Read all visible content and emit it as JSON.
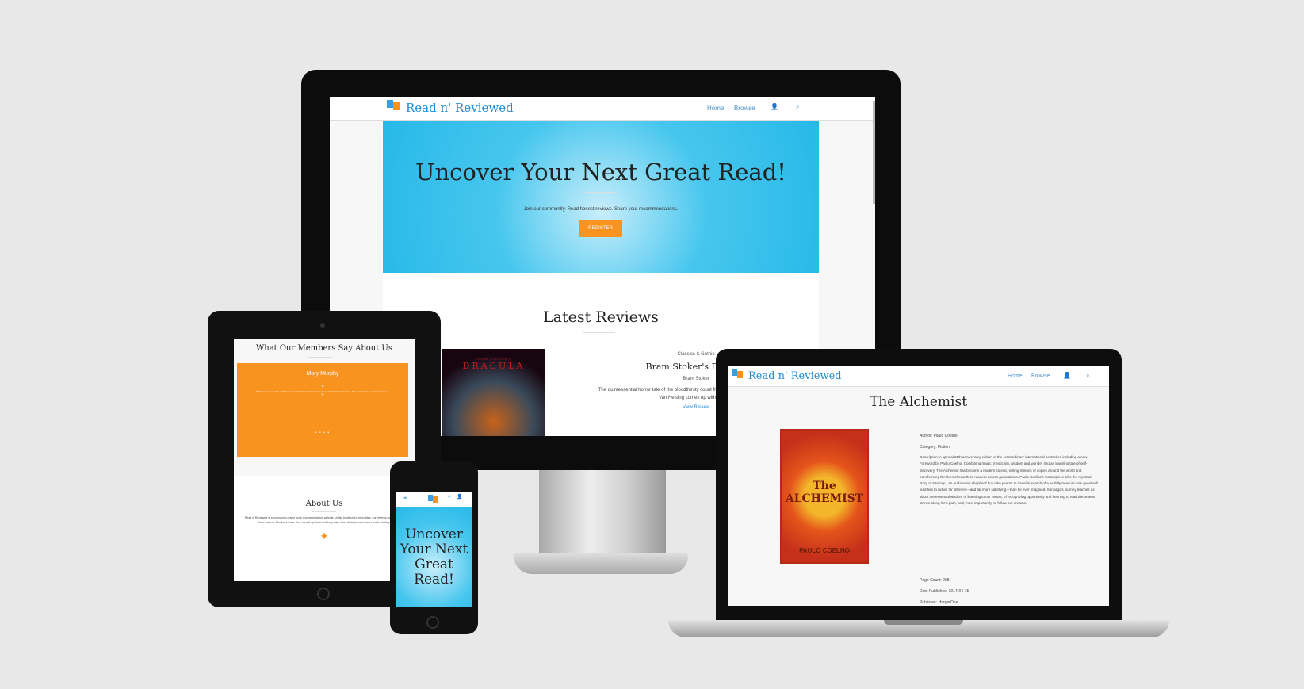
{
  "brand": "Read n' Reviewed",
  "nav": {
    "home": "Home",
    "browse": "Browse"
  },
  "desktop": {
    "hero_title": "Uncover Your Next Great Read!",
    "hero_subtitle": "Join our community. Read honest reviews. Share your recommendations.",
    "register": "REGISTER",
    "latest_title": "Latest Reviews",
    "review": {
      "cover_top": "BRAM STOKER'S",
      "cover_title": "DRACULA",
      "category": "Classics & Gothic",
      "title": "Bram Stoker's Dracula",
      "author": "Bram Stoker",
      "desc": "The quintessential horror tale of the bloodthirsty count from the mountains of Central Europe. Van Helsing comes up with a way...",
      "link": "View Review"
    }
  },
  "tablet": {
    "testimonials_title": "What Our Members Say About Us",
    "member": "Mary Murphy",
    "quote": "What I love about this platform is how it helps me discover books I wouldn't find otherwise. The community reviews are honest.",
    "about_title": "About Us",
    "about_text": "Read n' Reviewed is a community-driven book recommendation website. Unlike traditional review sites, our reviews come directly from readers. Members share their honest opinions and help each other discover new books worth reading."
  },
  "phone": {
    "hero_title": "Uncover Your Next Great Read!"
  },
  "laptop": {
    "book_title": "The Alchemist",
    "cover_title": "The ALCHEMIST",
    "cover_author": "PAULO COELHO",
    "author": "Author: Paulo Coelho",
    "category": "Category: Fiction",
    "description": "Description: A special 25th anniversary edition of the extraordinary international bestseller, including a new Foreword by Paulo Coelho. Combining magic, mysticism, wisdom and wonder into an inspiring tale of self-discovery, The Alchemist has become a modern classic, selling millions of copies around the world and transforming the lives of countless readers across generations. Paulo Coelho's masterpiece tells the mystical story of Santiago, an Andalusian shepherd boy who yearns to travel in search of a worldly treasure. His quest will lead him to riches far different—and far more satisfying—than he ever imagined. Santiago's journey teaches us about the essential wisdom of listening to our hearts, of recognizing opportunity and learning to read the omens strewn along life's path, and, most importantly, to follow our dreams.",
    "page_count": "Page Count: 208",
    "date": "Date Published: 2014-04-15",
    "publisher": "Publisher: HarperOne"
  },
  "colors": {
    "accent": "#1d8bd6",
    "orange": "#f7931e",
    "hero": "#27b9e8"
  }
}
